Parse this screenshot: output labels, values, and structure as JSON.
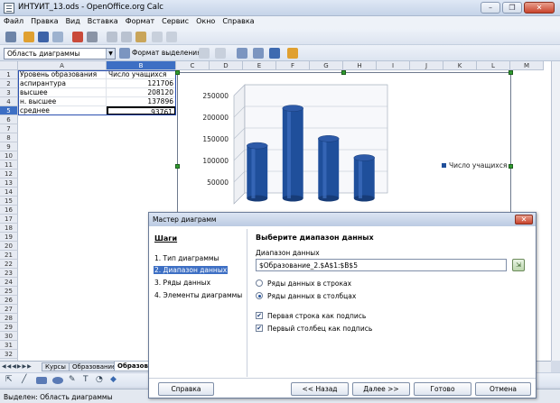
{
  "window": {
    "title": "ИНТУИТ_13.ods - OpenOffice.org Calc"
  },
  "menu": [
    "Файл",
    "Правка",
    "Вид",
    "Вставка",
    "Формат",
    "Сервис",
    "Окно",
    "Справка"
  ],
  "toolbar2": {
    "name_box": "Область диаграммы",
    "format_selection": "Формат выделения"
  },
  "columns": [
    "A",
    "B",
    "C",
    "D",
    "E",
    "F",
    "G",
    "H",
    "I",
    "J",
    "K",
    "L",
    "M"
  ],
  "rows": [
    "1",
    "2",
    "3",
    "4",
    "5",
    "6",
    "7",
    "8",
    "9",
    "10",
    "11",
    "12",
    "13",
    "14",
    "15",
    "16",
    "17",
    "18",
    "19",
    "20",
    "21",
    "22",
    "23",
    "24",
    "25",
    "26",
    "27",
    "28",
    "29",
    "30",
    "31",
    "32",
    "33"
  ],
  "cells": {
    "a": [
      "Уровень образования",
      "аспирантура",
      "высшее",
      "н. высшее",
      "среднее"
    ],
    "b": [
      "Число учащихся",
      "121706",
      "208120",
      "137896",
      "93761"
    ]
  },
  "chart_data": {
    "type": "bar",
    "categories": [
      "аспирантура",
      "высшее",
      "н. высшее",
      "среднее"
    ],
    "series": [
      {
        "name": "Число учащихся",
        "values": [
          121706,
          208120,
          137896,
          93761
        ]
      }
    ],
    "yticks": [
      "250000",
      "200000",
      "150000",
      "100000",
      "50000"
    ],
    "ylim": [
      0,
      250000
    ],
    "legend": "right",
    "bar_color": "#1f4f9b"
  },
  "sheet_tabs": [
    "Курсы",
    "Образование",
    "Образова"
  ],
  "status": {
    "text": "Выделен: Область диаграммы"
  },
  "dialog": {
    "title": "Мастер диаграмм",
    "steps_header": "Шаги",
    "steps": [
      "1. Тип диаграммы",
      "2. Диапазон данных",
      "3. Ряды данных",
      "4. Элементы диаграммы"
    ],
    "heading": "Выберите диапазон данных",
    "range_label": "Диапазон данных",
    "range_value": "$Образование_2.$A$1:$B$5",
    "radio_rows": "Ряды данных в строках",
    "radio_cols": "Ряды данных в столбцах",
    "check_first_row": "Первая строка как подпись",
    "check_first_col": "Первый столбец как подпись",
    "buttons": {
      "help": "Справка",
      "back": "<< Назад",
      "next": "Далее >>",
      "finish": "Готово",
      "cancel": "Отмена"
    }
  }
}
